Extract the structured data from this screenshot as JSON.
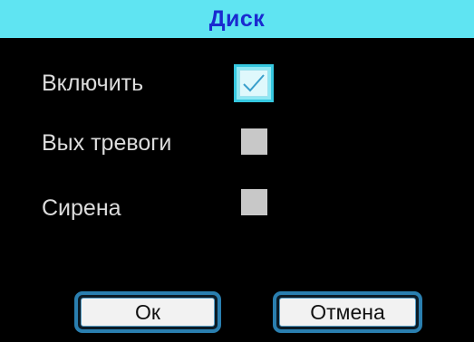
{
  "title": "Диск",
  "rows": [
    {
      "label": "Включить",
      "checked": true
    },
    {
      "label": "Вых тревоги",
      "checked": false
    },
    {
      "label": "Сирена",
      "checked": false
    }
  ],
  "buttons": {
    "ok_label": "Ок",
    "cancel_label": "Отмена"
  },
  "colors": {
    "title_bar": "#5fe4f2",
    "title_text": "#1a2ad0",
    "background": "#000000",
    "label_text": "#dcdcdc",
    "focus_border": "#36c8e0",
    "checkbox_unchecked": "#c8c8c8",
    "button_border": "#2a7fb0"
  },
  "icons": {
    "checked": "checkmark-icon"
  }
}
